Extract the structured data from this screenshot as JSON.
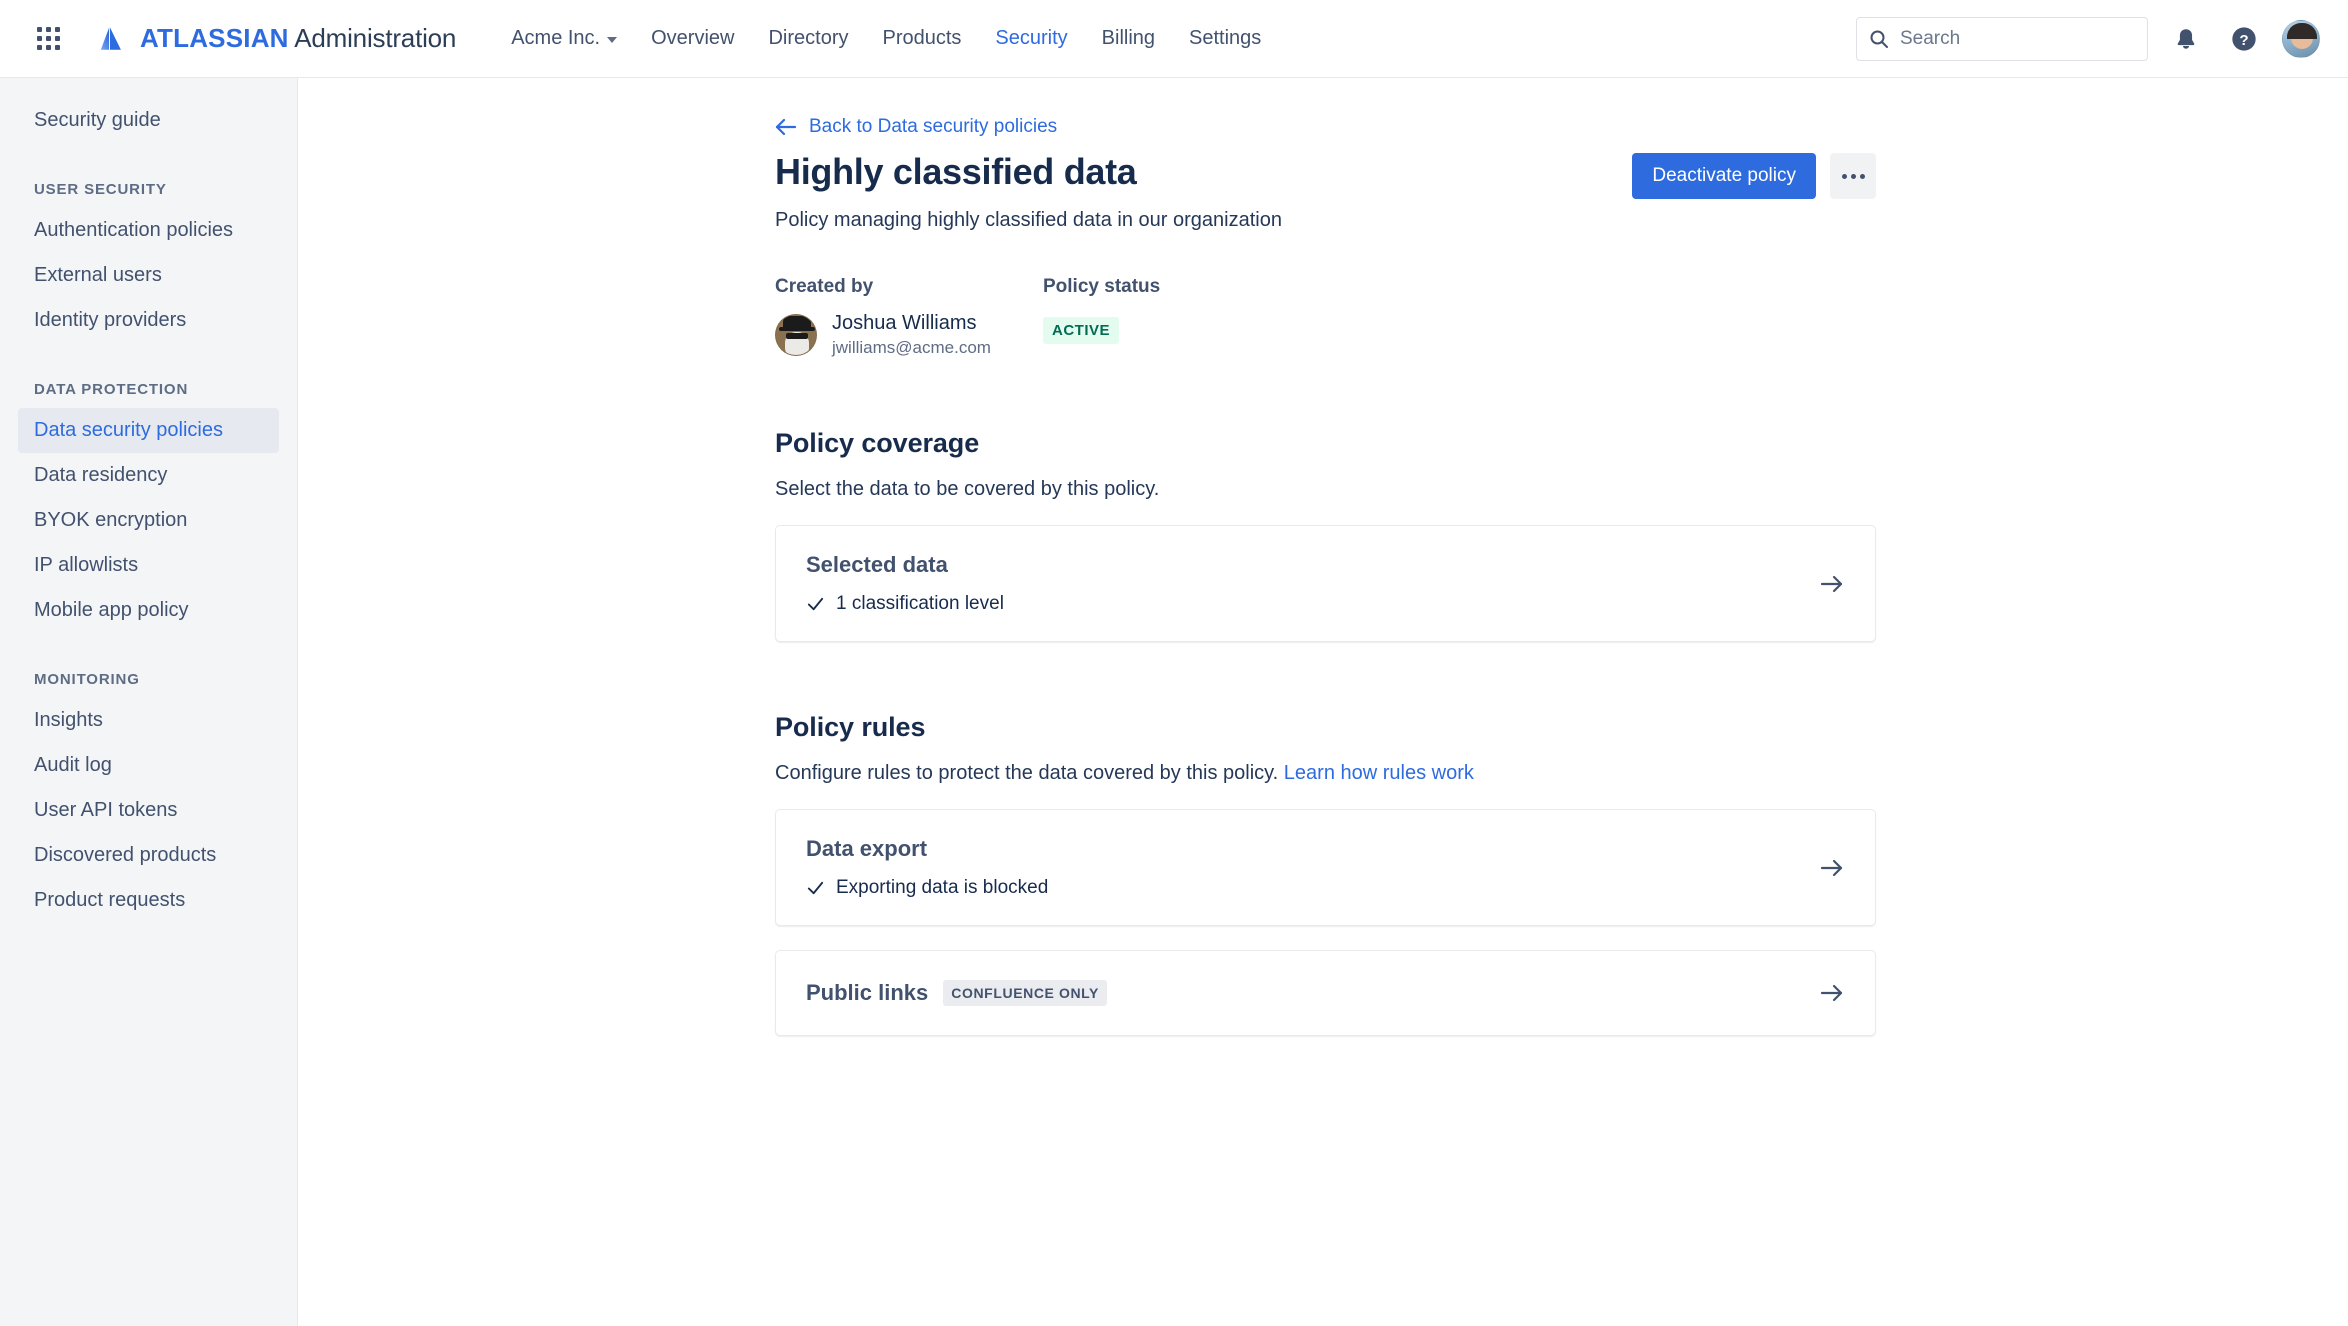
{
  "topnav": {
    "app_switcher_icon": "grid-icon",
    "brand_bold": "ATLASSIAN",
    "brand_regular": "Administration",
    "org_switcher": "Acme Inc.",
    "links": [
      {
        "label": "Overview",
        "active": false
      },
      {
        "label": "Directory",
        "active": false
      },
      {
        "label": "Products",
        "active": false
      },
      {
        "label": "Security",
        "active": true
      },
      {
        "label": "Billing",
        "active": false
      },
      {
        "label": "Settings",
        "active": false
      }
    ],
    "search_placeholder": "Search",
    "search_value": "",
    "search_icon": "search-icon",
    "notifications_icon": "bell-icon",
    "help_icon": "help-circle-icon",
    "avatar_icon": "user-avatar"
  },
  "sidebar": {
    "top_items": [
      {
        "label": "Security guide",
        "selected": false
      }
    ],
    "groups": [
      {
        "label": "USER SECURITY",
        "items": [
          {
            "label": "Authentication policies",
            "selected": false
          },
          {
            "label": "External users",
            "selected": false
          },
          {
            "label": "Identity providers",
            "selected": false
          }
        ]
      },
      {
        "label": "DATA PROTECTION",
        "items": [
          {
            "label": "Data security policies",
            "selected": true
          },
          {
            "label": "Data residency",
            "selected": false
          },
          {
            "label": "BYOK encryption",
            "selected": false
          },
          {
            "label": "IP allowlists",
            "selected": false
          },
          {
            "label": "Mobile app policy",
            "selected": false
          }
        ]
      },
      {
        "label": "MONITORING",
        "items": [
          {
            "label": "Insights",
            "selected": false
          },
          {
            "label": "Audit log",
            "selected": false
          },
          {
            "label": "User API tokens",
            "selected": false
          },
          {
            "label": "Discovered products",
            "selected": false
          },
          {
            "label": "Product requests",
            "selected": false
          }
        ]
      }
    ]
  },
  "page": {
    "back_link": "Back to Data security policies",
    "back_icon": "arrow-left-icon",
    "title": "Highly classified data",
    "subtitle": "Policy managing highly classified data in our organization",
    "primary_action": "Deactivate policy",
    "more_actions_icon": "more-horizontal-icon",
    "created_by_label": "Created by",
    "creator_name": "Joshua Williams",
    "creator_email": "jwilliams@acme.com",
    "policy_status_label": "Policy status",
    "policy_status_value": "ACTIVE"
  },
  "coverage": {
    "title": "Policy coverage",
    "description": "Select the data to be covered by this policy.",
    "card": {
      "title": "Selected data",
      "check_icon": "check-icon",
      "detail": "1 classification level",
      "arrow_icon": "arrow-right-icon"
    }
  },
  "rules": {
    "title": "Policy rules",
    "description": "Configure rules to protect the data covered by this policy.",
    "link": "Learn how rules work",
    "cards": [
      {
        "title": "Data export",
        "badge": "",
        "check_icon": "check-icon",
        "detail": "Exporting data is blocked",
        "arrow_icon": "arrow-right-icon"
      },
      {
        "title": "Public links",
        "badge": "CONFLUENCE ONLY",
        "check_icon": "",
        "detail": "",
        "arrow_icon": "arrow-right-icon"
      }
    ]
  },
  "colors": {
    "brand_blue": "#2d6bdf",
    "link_blue": "#2d6bdf",
    "status_green_bg": "#e3fcef",
    "status_green_text": "#036b52",
    "sidebar_bg": "#f4f5f7",
    "text_primary": "#172b4d",
    "text_muted": "#5e6c84"
  }
}
